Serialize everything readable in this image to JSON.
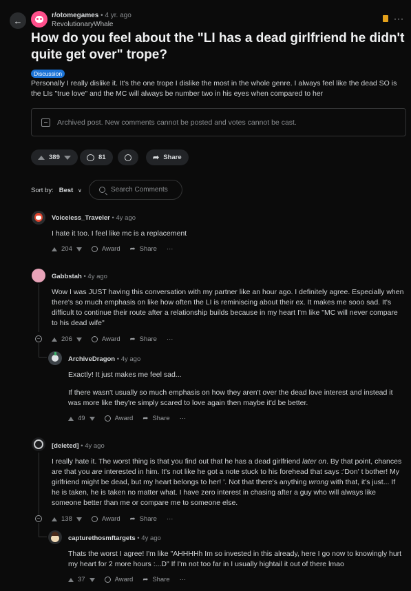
{
  "post": {
    "subreddit": "r/otomegames",
    "age": "4 yr. ago",
    "author": "RevolutionaryWhale",
    "title": "How do you feel about the \"LI has a dead girlfriend he didn't quite get over\" trope?",
    "flair": "Discussion",
    "body": "Personally I really dislike it. It's the one trope I dislike the most in the whole genre. I always feel like the dead SO is the LIs \"true love\" and the MC will always be number two in his eyes when compared to her",
    "archived_notice": "Archived post. New comments cannot be posted and votes cannot be cast.",
    "votes": "389",
    "comments": "81",
    "share_label": "Share"
  },
  "sort": {
    "label": "Sort by:",
    "value": "Best"
  },
  "search": {
    "placeholder": "Search Comments"
  },
  "comments": [
    {
      "user": "Voiceless_Traveler",
      "age": "4y ago",
      "text": "I hate it too. I feel like mc is a replacement",
      "votes": "204",
      "award": "Award",
      "share": "Share",
      "more": "···"
    },
    {
      "user": "Gabbstah",
      "age": "4y ago",
      "text": "Wow I was JUST having this conversation with my partner like an hour ago. I definitely agree. Especially when there's so much emphasis on like how often the LI is reminiscing about their ex. It makes me sooo sad. It's difficult to continue their route after a relationship builds because in my heart I'm like \"MC will never compare to his dead wife\"",
      "votes": "206",
      "award": "Award",
      "share": "Share",
      "more": "···"
    },
    {
      "user": "ArchiveDragon",
      "age": "4y ago",
      "text1": "Exactly! It just makes me feel sad...",
      "text2": "If there wasn't usually so much emphasis on how they aren't over the dead love interest and instead it was more like they're simply scared to love again then maybe it'd be better.",
      "votes": "49",
      "award": "Award",
      "share": "Share",
      "more": "···"
    },
    {
      "user": "[deleted]",
      "age": "4y ago",
      "text_a": "I really hate it. The worst thing is that you find out that he has a dead girlfriend ",
      "text_b": "later on",
      "text_c": ". By that point, chances are that you ",
      "text_d": "are",
      "text_e": " interested in him. It's not like he got a note stuck to his forehead that says :'Don' t bother! My girlfriend might be dead, but my heart belongs to her! '. Not that there's anything ",
      "text_f": "wrong",
      "text_g": " with that, it's just... If he is taken, he is taken no matter what. I have zero interest in chasing after a guy who will always like someone better than me or compare me to someone else.",
      "votes": "138",
      "award": "Award",
      "share": "Share",
      "more": "···"
    },
    {
      "user": "capturethosmftargets",
      "age": "4y ago",
      "text": "Thats the worst I agree! I'm like \"AHHHHh Im so invested in this already, here I go now to knowingly hurt my heart for 2 more hours :...D\" If I'm not too far in I usually hightail it out of there lmao",
      "votes": "37",
      "award": "Award",
      "share": "Share",
      "more": "···"
    }
  ],
  "colors": {
    "background": "#0b0b0b",
    "flair": "#1b73d6",
    "subreddit_avatar": "#ff4f8b",
    "bookmark": "#e4a11b"
  }
}
